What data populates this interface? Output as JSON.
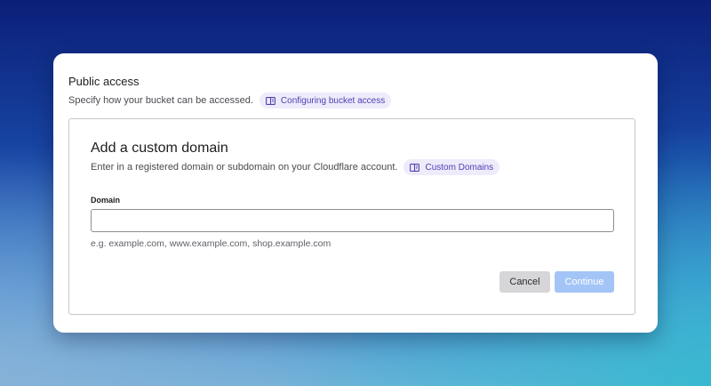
{
  "public_access": {
    "title": "Public access",
    "description": "Specify how your bucket can be accessed.",
    "doc_link": {
      "label": "Configuring bucket access",
      "icon": "book-icon"
    }
  },
  "custom_domain": {
    "title": "Add a custom domain",
    "description": "Enter in a registered domain or subdomain on your Cloudflare account.",
    "doc_link": {
      "label": "Custom Domains",
      "icon": "book-icon"
    },
    "field": {
      "label": "Domain",
      "value": "",
      "placeholder": "",
      "hint": "e.g. example.com, www.example.com, shop.example.com"
    },
    "actions": {
      "cancel_label": "Cancel",
      "continue_label": "Continue"
    }
  },
  "colors": {
    "pill_background": "#eeebfb",
    "pill_text": "#4e42b3",
    "continue_disabled": "#a3c4f7",
    "cancel_background": "#d6d6d9"
  }
}
